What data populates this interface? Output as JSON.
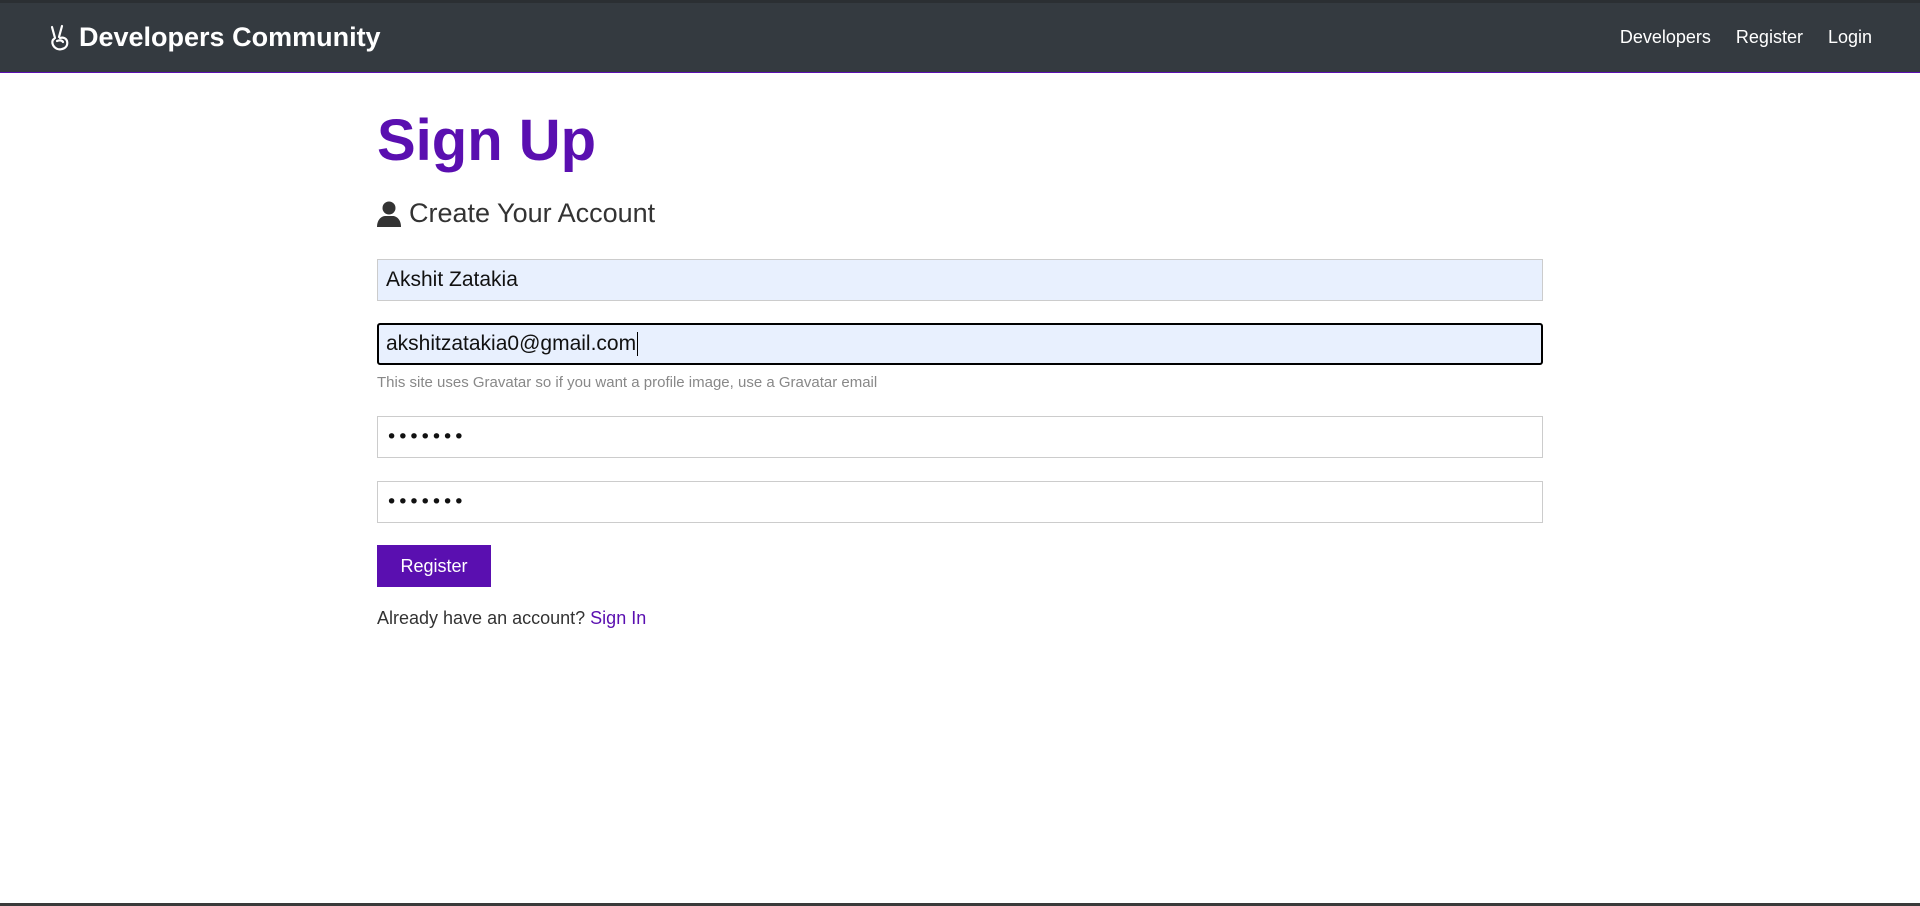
{
  "navbar": {
    "brand": "Developers Community",
    "brand_icon": "peace-hand-icon",
    "links": [
      "Developers",
      "Register",
      "Login"
    ]
  },
  "page": {
    "title": "Sign Up",
    "lead": "Create Your Account",
    "lead_icon": "user-icon"
  },
  "form": {
    "name_value": "Akshit Zatakia",
    "email_value": "akshitzatakia0@gmail.com",
    "email_help": "This site uses Gravatar so if you want a profile image, use a Gravatar email",
    "password_mask": "•••••••",
    "password2_mask": "•••••••",
    "submit_label": "Register"
  },
  "footer_text": {
    "prompt": "Already have an account?",
    "link": "Sign In"
  },
  "colors": {
    "primary": "#5a0fb0",
    "navbar": "#343a40",
    "autofill": "#e8f0fe"
  }
}
